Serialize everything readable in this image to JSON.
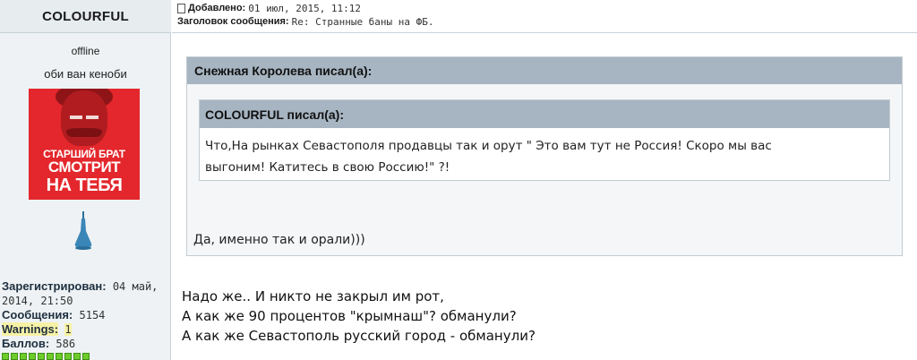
{
  "user": {
    "username": "COLOURFUL",
    "status": "offline",
    "title": "оби ван кеноби",
    "avatar": {
      "line1": "СТАРШИЙ БРАТ",
      "line2": "СМОТРИТ",
      "line3": "НА ТЕБЯ",
      "bg_color": "#e3272c"
    },
    "rank_icon": "bell-rank-icon",
    "profile": {
      "registered_label": "Зарегистрирован:",
      "registered_value": "04 май, 2014, 21:50",
      "messages_label": "Сообщения:",
      "messages_value": "5154",
      "warnings_label": "Warnings:",
      "warnings_value": "1",
      "points_label": "Баллов:",
      "points_value": "586",
      "reputation_squares": 10
    }
  },
  "post": {
    "added_label": "Добавлено:",
    "added_value": "01 июл, 2015, 11:12",
    "subject_label": "Заголовок сообщения:",
    "subject_value": "Re: Странные баны на ФБ.",
    "outer_quote": {
      "author": "Снежная Королева писал(а):",
      "inner_quote": {
        "author": "COLOURFUL писал(а):",
        "line1": "Что,На рынках Севастополя продавцы так и орут \" Это вам тут не Россия! Скоро мы вас",
        "line2": "выгоним! Катитесь в свою Россию!\" ?!"
      },
      "reply": "Да, именно так и орали)))"
    },
    "body": {
      "line1": "Надо же.. И никто не закрыл им рот,",
      "line2": "А как же 90 процентов \"крымнаш\"? обманули?",
      "line3": "А как же Севастополь русский город - обманули?"
    }
  },
  "colors": {
    "sidebar_bg": "#eef2f4",
    "quote_header": "#a7b5c2",
    "warning_highlight": "#f7f2a6",
    "reputation_green": "#6dcc2a"
  }
}
